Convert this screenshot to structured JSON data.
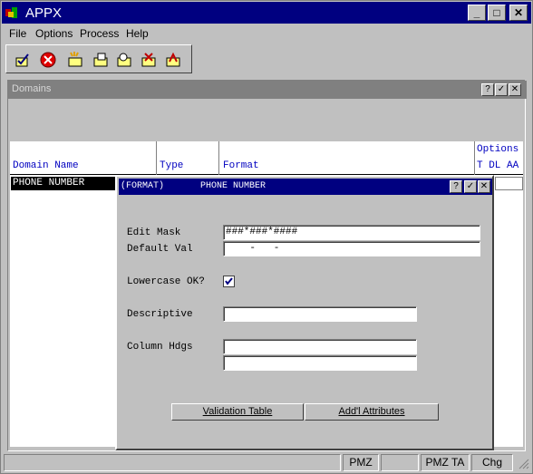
{
  "app": {
    "title": "APPX",
    "menu": [
      {
        "label": "File"
      },
      {
        "label": "Options"
      },
      {
        "label": "Process"
      },
      {
        "label": "Help"
      }
    ],
    "window_controls": {
      "minimize": "_",
      "maximize": "□",
      "close": "✕"
    }
  },
  "domains": {
    "title": "Domains",
    "controls": {
      "help": "?",
      "ok": "✓",
      "close": "✕"
    },
    "columns": {
      "domain_name": "Domain Name",
      "type": "Type",
      "format": "Format",
      "options": "Options",
      "options_sub": "T DL AA"
    },
    "selected_row": "PHONE NUMBER"
  },
  "dialog": {
    "title_left": "(FORMAT)",
    "title_right": "PHONE NUMBER",
    "controls": {
      "help": "?",
      "ok": "✓",
      "close": "✕"
    },
    "fields": {
      "edit_mask_label": "Edit Mask",
      "edit_mask_value": "###*###*####",
      "default_val_label": "Default Val",
      "default_val_value": "    -   -",
      "lowercase_label": "Lowercase OK?",
      "lowercase_checked": true,
      "descriptive_label": "Descriptive",
      "descriptive_value": "",
      "column_hdgs_label": "Column Hdgs",
      "column_hdgs_1": "",
      "column_hdgs_2": ""
    },
    "buttons": {
      "validation_table": "Validation Table",
      "addl_attributes": "Add'l Attributes"
    }
  },
  "statusbar": {
    "cells": [
      "",
      "PMZ",
      "",
      "PMZ TA",
      "Chg"
    ]
  },
  "colors": {
    "title_active": "#000080",
    "title_inactive": "#808080",
    "header_text": "#0000c0",
    "face": "#c0c0c0"
  }
}
